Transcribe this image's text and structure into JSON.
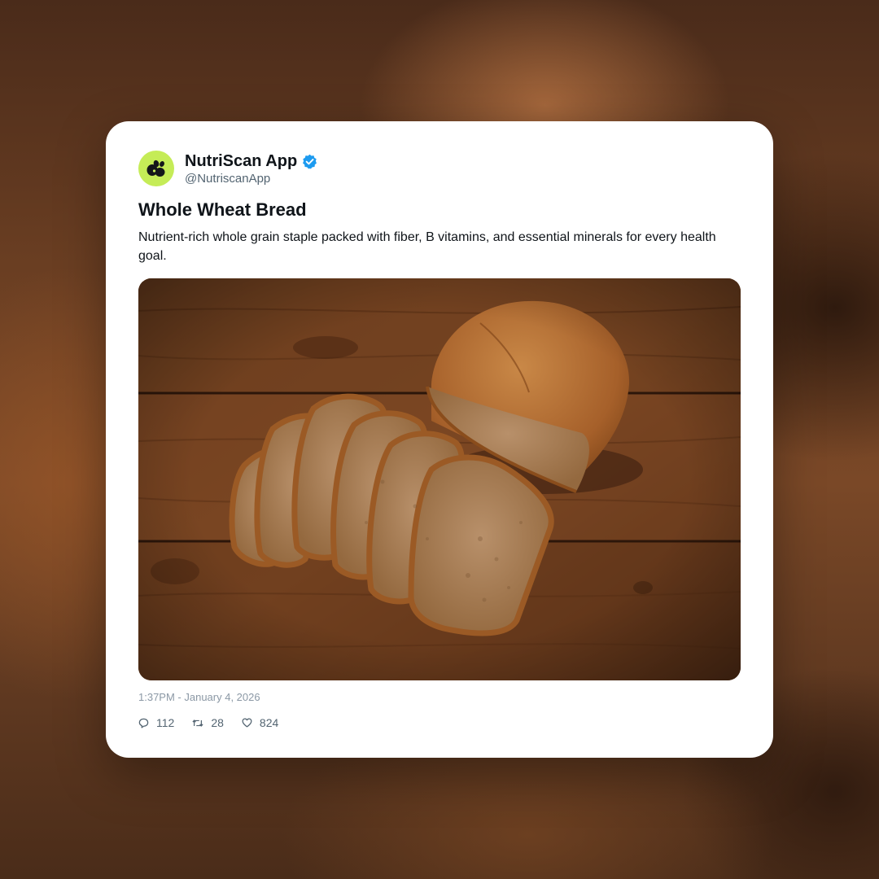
{
  "post": {
    "author": {
      "name": "NutriScan App",
      "handle": "@NutriscanApp",
      "verified": true,
      "avatar_color": "#c5ec57",
      "avatar_icon": "leaf-logo-icon"
    },
    "title": "Whole Wheat Bread",
    "description": "Nutrient-rich whole grain staple packed with fiber, B vitamins, and essential minerals for every health goal.",
    "image": {
      "subject": "sliced whole wheat loaf on wooden table"
    },
    "timestamp": "1:37PM - January 4, 2026",
    "stats": {
      "replies": "112",
      "reposts": "28",
      "likes": "824"
    }
  },
  "colors": {
    "verified_badge": "#1d9bf0",
    "text_primary": "#0f1419",
    "text_secondary": "#536471"
  }
}
